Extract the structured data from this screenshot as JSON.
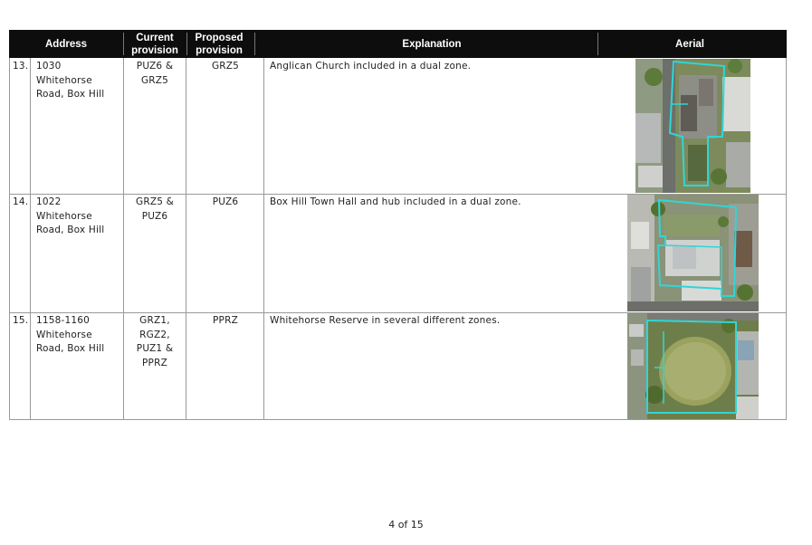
{
  "table": {
    "headers": {
      "address": "Address",
      "current": "Current provision",
      "proposed": "Proposed provision",
      "explanation": "Explanation",
      "aerial": "Aerial"
    },
    "rows": [
      {
        "num": "13.",
        "address": "1030 Whitehorse Road, Box Hill",
        "current": "PUZ6 & GRZ5",
        "proposed": "GRZ5",
        "explanation": "Anglican Church included in a dual zone."
      },
      {
        "num": "14.",
        "address": "1022 Whitehorse Road, Box Hill",
        "current": "GRZ5 & PUZ6",
        "proposed": "PUZ6",
        "explanation": "Box Hill Town Hall and hub included in a dual zone."
      },
      {
        "num": "15.",
        "address": "1158-1160 Whitehorse Road, Box Hill",
        "current": "GRZ1, RGZ2, PUZ1 & PPRZ",
        "proposed": "PPRZ",
        "explanation": "Whitehorse Reserve in several different zones."
      }
    ]
  },
  "footer": {
    "page": "4 of 15"
  },
  "colors": {
    "header_bg": "#0d0d0d",
    "outline": "#2fd6d6"
  }
}
